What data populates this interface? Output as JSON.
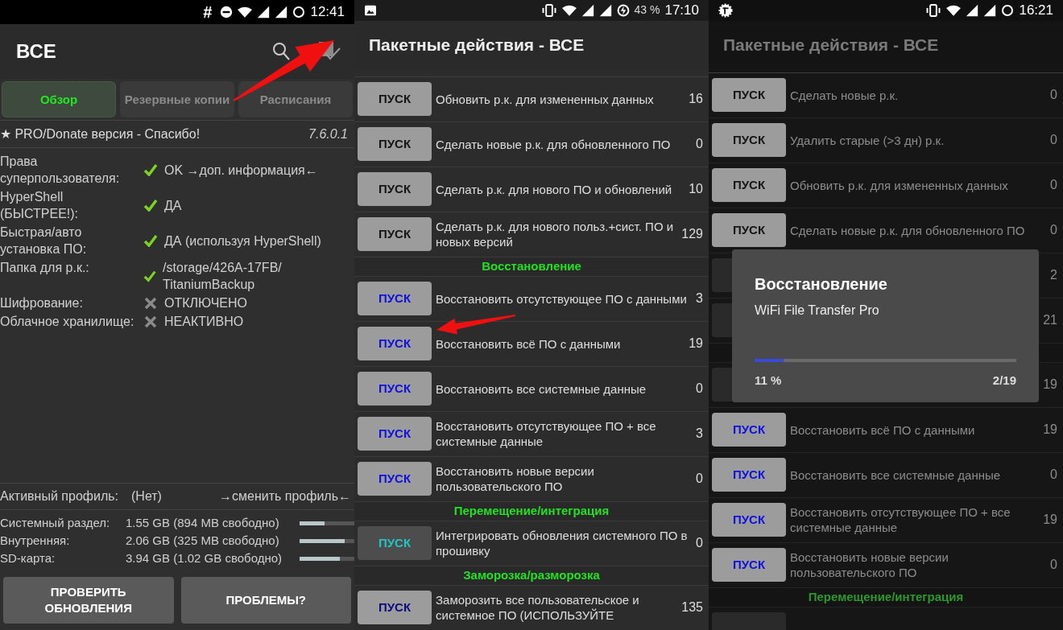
{
  "screens": [
    {
      "kind": "overview",
      "status": {
        "hash": "#",
        "time": "12:41"
      },
      "title": "ВСЕ",
      "tabs": [
        {
          "label": "Обзор",
          "selected": true
        },
        {
          "label": "Резервные копии",
          "selected": false
        },
        {
          "label": "Расписания",
          "selected": false
        }
      ],
      "banner": "★ PRO/Donate версия - Спасибо!",
      "version": "7.6.0.1",
      "checks": [
        {
          "label": "Права суперпользователя:",
          "value": "OK →доп. информация←",
          "ok": true
        },
        {
          "label": "HyperShell (БЫСТРЕЕ!):",
          "value": "ДА",
          "ok": true
        },
        {
          "label": "Быстрая/авто установка ПО:",
          "value": "ДА (используя HyperShell)",
          "ok": true
        },
        {
          "label": "Папка для р.к.:",
          "value": "/storage/426A-17FB/ TitaniumBackup",
          "ok": true
        },
        {
          "label": "Шифрование:",
          "value": "ОТКЛЮЧЕНО",
          "ok": false
        },
        {
          "label": "Облачное хранилище:",
          "value": "НЕАКТИВНО",
          "ok": false
        }
      ],
      "profile": {
        "label": "Активный профиль:",
        "value": "(Нет)",
        "link": "→сменить профиль←"
      },
      "storage": [
        {
          "label": "Системный раздел:",
          "value": "1.55 GB (894 MB свободно)",
          "level": 0.45
        },
        {
          "label": "Внутренняя:",
          "value": "2.06 GB (325 MB свободно)",
          "level": 0.83
        },
        {
          "label": "SD-карта:",
          "value": "3.94 GB (1.02 GB свободно)",
          "level": 0.73
        }
      ],
      "buttons": [
        "ПРОВЕРИТЬ ОБНОВЛЕНИЯ",
        "ПРОБЛЕМЫ?"
      ]
    },
    {
      "kind": "batch",
      "status": {
        "battery": "43 %",
        "time": "17:10"
      },
      "title": "Пакетные действия - ВСЕ",
      "dimmed": false,
      "items": [
        {
          "kind": "action",
          "button": "ПУСК",
          "color": "#151515",
          "label": "Обновить р.к. для измененных данных",
          "count": "16"
        },
        {
          "kind": "action",
          "button": "ПУСК",
          "color": "#151515",
          "label": "Сделать новые р.к. для обновленного ПО",
          "count": "0"
        },
        {
          "kind": "action",
          "button": "ПУСК",
          "color": "#151515",
          "label": "Сделать р.к. для нового ПО и обновлений",
          "count": "10"
        },
        {
          "kind": "action",
          "button": "ПУСК",
          "color": "#151515",
          "label": "Сделать р.к. для нового польз.+сист. ПО и новых версий",
          "count": "129"
        },
        {
          "kind": "header",
          "label": "Восстановление"
        },
        {
          "kind": "action",
          "button": "ПУСК",
          "color": "#1010e0",
          "label": "Восстановить отсутствующее ПО с данными",
          "count": "3"
        },
        {
          "kind": "action",
          "button": "ПУСК",
          "color": "#1010e0",
          "label": "Восстановить всё ПО с данными",
          "count": "19"
        },
        {
          "kind": "action",
          "button": "ПУСК",
          "color": "#1010e0",
          "label": "Восстановить все системные данные",
          "count": "0"
        },
        {
          "kind": "action",
          "button": "ПУСК",
          "color": "#1010e0",
          "label": "Восстановить отсутствующее ПО + все системные данные",
          "count": "3"
        },
        {
          "kind": "action",
          "button": "ПУСК",
          "color": "#1010e0",
          "label": "Восстановить новые версии пользовательского ПО",
          "count": "0"
        },
        {
          "kind": "header",
          "label": "Перемещение/интеграция"
        },
        {
          "kind": "action",
          "button": "ПУСК",
          "color": "#22c4c4",
          "label": "Интегрировать обновления системного ПО в прошивку",
          "count": "0"
        },
        {
          "kind": "header",
          "label": "Заморозка/разморозка"
        },
        {
          "kind": "action",
          "button": "ПУСК",
          "color": "#0c0c80",
          "label": "Заморозить все пользовательское и системное ПО (ИСПОЛЬЗУЙТЕ",
          "count": "135"
        }
      ]
    },
    {
      "kind": "batch",
      "status": {
        "time": "16:21"
      },
      "title": "Пакетные действия - ВСЕ",
      "dimmed": true,
      "items": [
        {
          "kind": "action",
          "button": "ПУСК",
          "color": "#151515",
          "label": "Сделать новые р.к.",
          "count": "0"
        },
        {
          "kind": "action",
          "button": "ПУСК",
          "color": "#151515",
          "label": "Удалить старые (>3 дн) р.к.",
          "count": "0"
        },
        {
          "kind": "action",
          "button": "ПУСК",
          "color": "#151515",
          "label": "Обновить р.к. для измененных данных",
          "count": "0"
        },
        {
          "kind": "action",
          "button": "ПУСК",
          "color": "#151515",
          "label": "Сделать новые р.к. для обновленного ПО",
          "count": "0"
        },
        {
          "kind": "covered",
          "count": "2"
        },
        {
          "kind": "covered",
          "count": "21"
        },
        {
          "kind": "covered_header"
        },
        {
          "kind": "covered",
          "count": "19"
        },
        {
          "kind": "action",
          "button": "ПУСК",
          "color": "#1010e0",
          "label": "Восстановить всё ПО с данными",
          "count": "19"
        },
        {
          "kind": "action",
          "button": "ПУСК",
          "color": "#1010e0",
          "label": "Восстановить все системные данные",
          "count": "0"
        },
        {
          "kind": "action",
          "button": "ПУСК",
          "color": "#1010e0",
          "label": "Восстановить отсутствующее ПО + все системные данные",
          "count": "19"
        },
        {
          "kind": "action",
          "button": "ПУСК",
          "color": "#1010e0",
          "label": "Восстановить новые версии пользовательского ПО",
          "count": "0"
        },
        {
          "kind": "header",
          "label": "Перемещение/интеграция"
        },
        {
          "kind": "cut"
        }
      ],
      "dialog": {
        "title": "Восстановление",
        "subtitle": "WiFi File Transfer Pro",
        "level": 0.11,
        "percent": "11 %",
        "count": "2/19"
      }
    }
  ]
}
